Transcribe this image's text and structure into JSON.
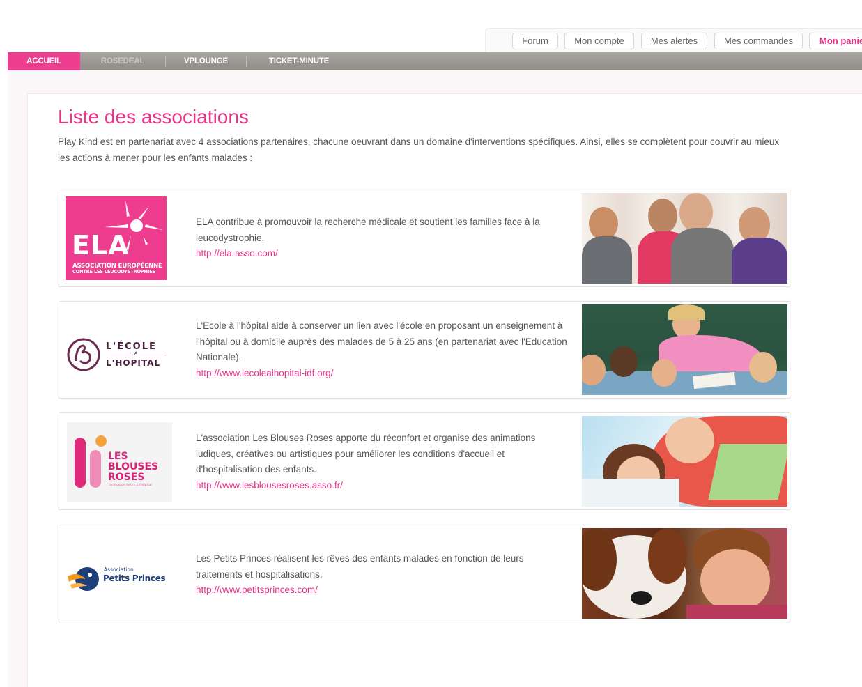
{
  "top_links": {
    "forum": "Forum",
    "account": "Mon compte",
    "alerts": "Mes alertes",
    "orders": "Mes commandes",
    "cart": "Mon panier"
  },
  "nav": {
    "items": [
      {
        "label": "ACCUEIL"
      },
      {
        "label": "ROSEDEAL"
      },
      {
        "label": "VPLOUNGE"
      },
      {
        "label": "TICKET-MINUTE"
      }
    ]
  },
  "page": {
    "title": "Liste des associations",
    "intro": "Play Kind est en partenariat avec 4 associations partenaires, chacune oeuvrant  dans un domaine d'interventions spécifiques. Ainsi, elles se complètent pour couvrir au mieux les actions à mener pour les enfants malades :"
  },
  "associations": [
    {
      "logo_text": "ELA",
      "logo_sub1": "ASSOCIATION EUROPÉENNE",
      "logo_sub2": "CONTRE LES LEUCODYSTROPHIES",
      "description": "ELA contribue à promouvoir la recherche médicale et soutient les familles face à la leucodystrophie.",
      "url": "http://ela-asso.com/"
    },
    {
      "logo_line1": "L'ÉCOLE",
      "logo_mid": "A",
      "logo_line2": "L'HOPITAL",
      "description": "L'École à l'hôpital aide à conserver un lien avec l'école en proposant un enseignement à l'hôpital ou à domicile auprès des malades de 5 à 25 ans (en partenariat avec l'Education Nationale).",
      "url": "http://www.lecolealhopital-idf.org/"
    },
    {
      "logo_line1": "LES",
      "logo_line2": "BLOUSES",
      "logo_line3": "ROSES",
      "logo_tagline": "animation loisirs à l'hôpital",
      "description": "L'association Les Blouses Roses apporte du réconfort et organise des animations ludiques, créatives ou artistiques pour améliorer les conditions d'accueil et d'hospitalisation des enfants.",
      "url": "http://www.lesblousesroses.asso.fr/"
    },
    {
      "logo_small": "Association",
      "logo_name": "Petits Princes",
      "description": "Les Petits Princes réalisent les rêves des enfants malades en fonction de leurs traitements et hospitalisations.",
      "url": "http://www.petitsprinces.com/"
    }
  ],
  "colors": {
    "brand_pink": "#e8338a",
    "nav_active": "#ee3d8e",
    "nav_bg": "#9c9995"
  }
}
